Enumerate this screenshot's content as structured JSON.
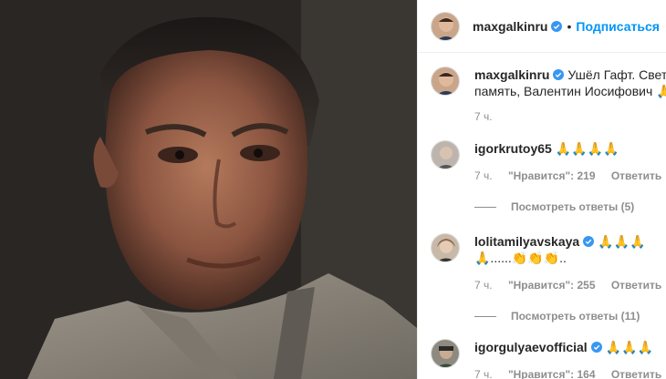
{
  "post": {
    "author": "maxgalkinru",
    "follow_label": "Подписаться",
    "separator": "•",
    "caption_user": "maxgalkinru",
    "caption_line1": "Ушёл Гафт. Светлая",
    "caption_line2": "память, Валентин Иосифович 🙏",
    "caption_time": "7 ч."
  },
  "comments": [
    {
      "user": "igorkrutoy65",
      "text": "🙏🙏🙏🙏",
      "time": "7 ч.",
      "likes": "\"Нравится\": 219",
      "reply": "Ответить",
      "view_replies": "Посмотреть ответы (5)"
    },
    {
      "user": "lolitamilyavskaya",
      "text": "🙏🙏🙏",
      "text2": "🙏......👏👏👏..",
      "time": "7 ч.",
      "likes": "\"Нравится\": 255",
      "reply": "Ответить",
      "view_replies": "Посмотреть ответы (11)"
    },
    {
      "user": "igorgulyaevofficial",
      "text": "🙏🙏🙏",
      "time": "7 ч.",
      "likes": "\"Нравится\": 164",
      "reply": "Ответить"
    }
  ],
  "colors": {
    "accent": "#0095f6",
    "verified": "#3897f0",
    "muted": "#8e8e8e"
  },
  "icons": {
    "verified": "verified-badge-icon"
  }
}
